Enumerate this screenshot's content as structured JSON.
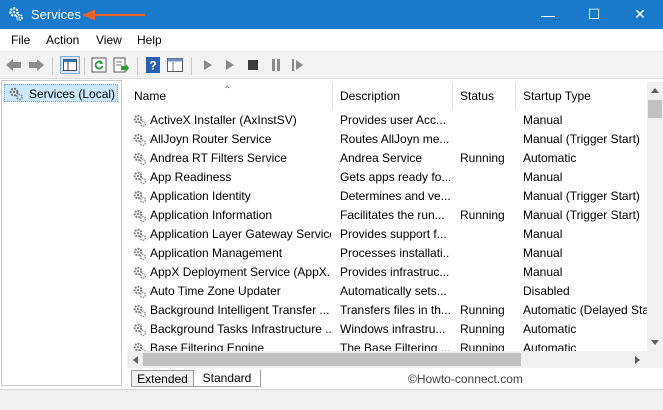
{
  "window": {
    "title": "Services",
    "controls": {
      "minimize": "—",
      "maximize": "☐",
      "close": "✕"
    }
  },
  "menu": [
    "File",
    "Action",
    "View",
    "Help"
  ],
  "tree": {
    "item": "Services (Local)"
  },
  "columns": [
    "Name",
    "Description",
    "Status",
    "Startup Type"
  ],
  "services": [
    {
      "name": "ActiveX Installer (AxInstSV)",
      "description": "Provides user Acc...",
      "status": "",
      "startup": "Manual"
    },
    {
      "name": "AllJoyn Router Service",
      "description": "Routes AllJoyn me...",
      "status": "",
      "startup": "Manual (Trigger Start)"
    },
    {
      "name": "Andrea RT Filters Service",
      "description": "Andrea Service",
      "status": "Running",
      "startup": "Automatic"
    },
    {
      "name": "App Readiness",
      "description": "Gets apps ready fo...",
      "status": "",
      "startup": "Manual"
    },
    {
      "name": "Application Identity",
      "description": "Determines and ve...",
      "status": "",
      "startup": "Manual (Trigger Start)"
    },
    {
      "name": "Application Information",
      "description": "Facilitates the run...",
      "status": "Running",
      "startup": "Manual (Trigger Start)"
    },
    {
      "name": "Application Layer Gateway Service",
      "description": "Provides support f...",
      "status": "",
      "startup": "Manual"
    },
    {
      "name": "Application Management",
      "description": "Processes installati...",
      "status": "",
      "startup": "Manual"
    },
    {
      "name": "AppX Deployment Service (AppX...",
      "description": "Provides infrastruc...",
      "status": "",
      "startup": "Manual"
    },
    {
      "name": "Auto Time Zone Updater",
      "description": "Automatically sets...",
      "status": "",
      "startup": "Disabled"
    },
    {
      "name": "Background Intelligent Transfer ...",
      "description": "Transfers files in th...",
      "status": "Running",
      "startup": "Automatic (Delayed Sta"
    },
    {
      "name": "Background Tasks Infrastructure ...",
      "description": "Windows infrastru...",
      "status": "Running",
      "startup": "Automatic"
    },
    {
      "name": "Base Filtering Engine",
      "description": "The Base Filtering ...",
      "status": "Running",
      "startup": "Automatic"
    }
  ],
  "tabs": [
    "Extended",
    "Standard"
  ],
  "active_tab": "Standard",
  "watermark": "©Howto-connect.com",
  "colors": {
    "titlebar": "#1979ca",
    "selection": "#cce8ff",
    "annotation_arrow": "#e8622c"
  }
}
